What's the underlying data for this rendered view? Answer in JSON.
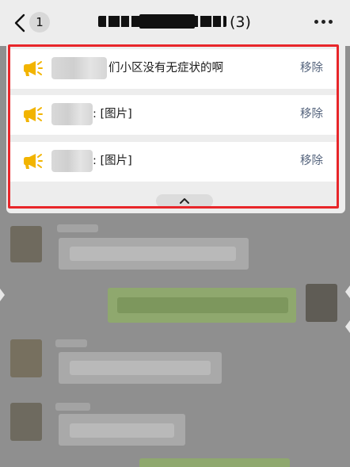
{
  "header": {
    "unread_count": "1",
    "group_member_count": "(3)"
  },
  "pinned_messages": {
    "items": [
      {
        "text": "们小区没有无症状的啊",
        "action": "移除"
      },
      {
        "text": ": [图片]",
        "action": "移除"
      },
      {
        "text": ": [图片]",
        "action": "移除"
      }
    ]
  },
  "colors": {
    "highlight_frame": "#e8262a",
    "megaphone_icon": "#f2b400",
    "remove_link": "#56657e",
    "panel_bg": "#ededed"
  },
  "icons": {
    "back": "chevron-left-icon",
    "more": "more-dots-icon",
    "pinned": "megaphone-icon",
    "collapse": "chevron-up-icon"
  }
}
